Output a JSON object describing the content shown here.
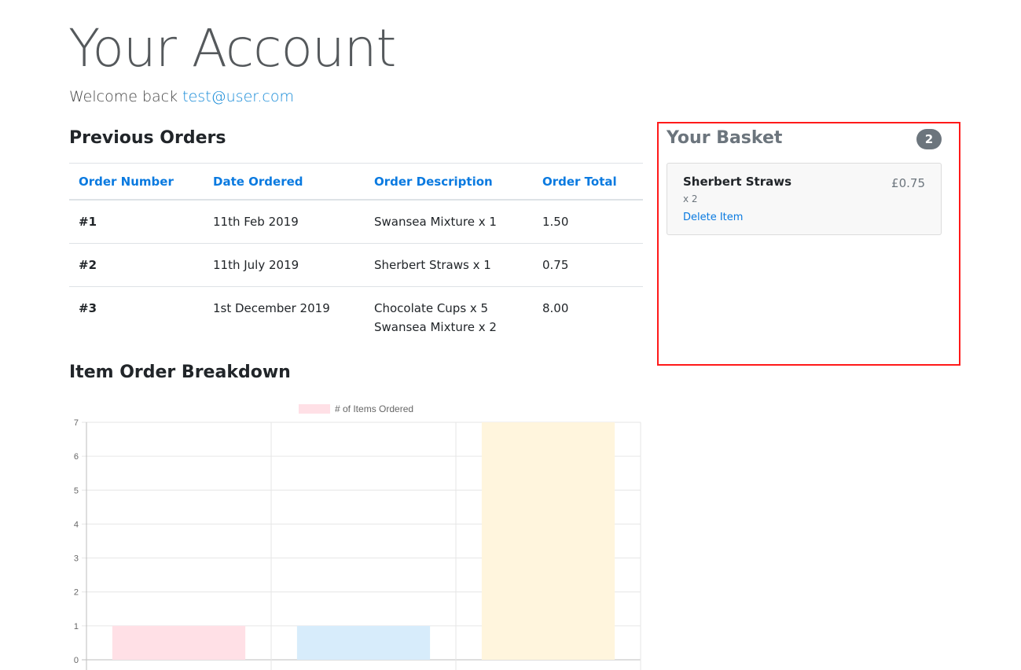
{
  "header": {
    "title": "Your Account",
    "welcome_prefix": "Welcome back",
    "user_email": "test@user.com"
  },
  "orders": {
    "title": "Previous Orders",
    "columns": [
      "Order Number",
      "Date Ordered",
      "Order Description",
      "Order Total"
    ],
    "rows": [
      {
        "number": "#1",
        "date": "11th Feb 2019",
        "description": [
          "Swansea Mixture x 1"
        ],
        "total": "1.50"
      },
      {
        "number": "#2",
        "date": "11th July 2019",
        "description": [
          "Sherbert Straws x 1"
        ],
        "total": "0.75"
      },
      {
        "number": "#3",
        "date": "1st December 2019",
        "description": [
          "Chocolate Cups x 5",
          "Swansea Mixture x 2"
        ],
        "total": "8.00"
      }
    ]
  },
  "basket": {
    "title": "Your Basket",
    "count": "2",
    "items": [
      {
        "name": "Sherbert Straws",
        "price": "£0.75",
        "quantity": "x 2",
        "delete_label": "Delete Item"
      }
    ]
  },
  "breakdown": {
    "title": "Item Order Breakdown"
  },
  "chart_data": {
    "type": "bar",
    "categories": [
      "",
      "",
      ""
    ],
    "series": [
      {
        "name": "# of Items Ordered",
        "values": [
          1,
          1,
          7
        ],
        "colors": [
          "#ffe0e6",
          "#d7ecfb",
          "#fff5dd"
        ]
      }
    ],
    "ylim": [
      0,
      7
    ],
    "yticks": [
      0,
      1,
      2,
      3,
      4,
      5,
      6,
      7
    ],
    "grid": true,
    "legend": "top"
  }
}
